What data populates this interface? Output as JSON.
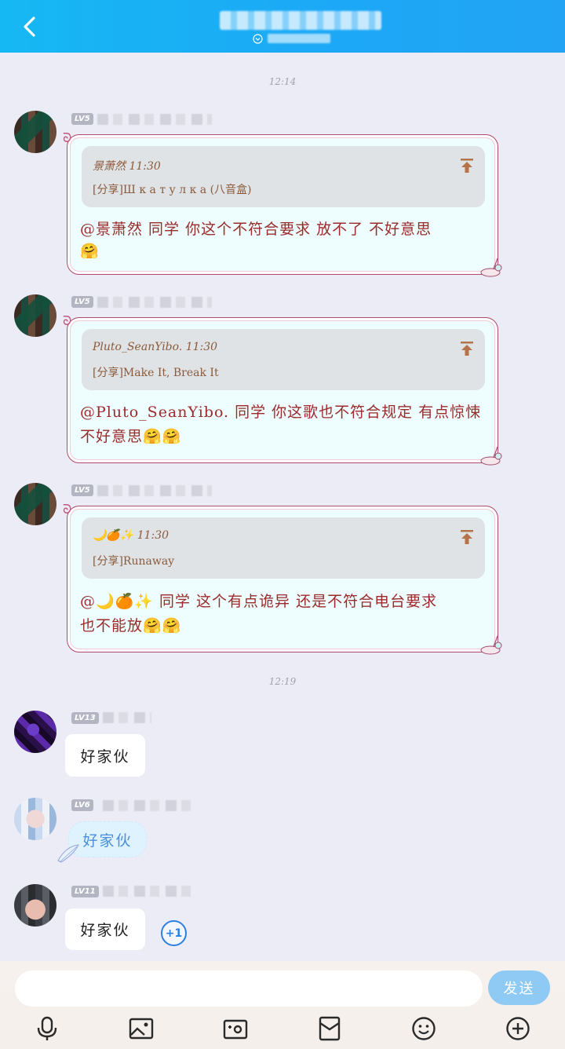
{
  "header": {
    "back_icon": "chevron-left-icon"
  },
  "timestamps": [
    "12:14",
    "12:19"
  ],
  "messages": [
    {
      "level": "LV5",
      "quote_author": "景萧然 11:30",
      "quote_content": "[分享]Ш к а т у л к а (八音盒)",
      "text_line1": "@景萧然 同学 你这个不符合要求 放不了 不好意思",
      "text_line2": "🤗"
    },
    {
      "level": "LV5",
      "quote_author": "Pluto_SeanYibo. 11:30",
      "quote_content": "[分享]Make It, Break It",
      "text_line1": "@Pluto_SeanYibo. 同学 你这歌也不符合规定 有点惊悚",
      "text_line2": "不好意思🤗🤗"
    },
    {
      "level": "LV5",
      "quote_author": "🌙🍊✨ 11:30",
      "quote_content": "[分享]Runaway",
      "text_line1": "@🌙🍊✨ 同学 这个有点诡异 还是不符合电台要求",
      "text_line2": "也不能放🤗🤗"
    },
    {
      "level": "LV13",
      "text": "好家伙"
    },
    {
      "level": "LV6",
      "text": "好家伙"
    },
    {
      "level": "LV11",
      "text": "好家伙",
      "plus_one": "+1"
    }
  ],
  "input": {
    "placeholder": "",
    "value": "",
    "send_label": "发送"
  },
  "toolbar": {
    "icons": [
      "microphone-icon",
      "image-icon",
      "camera-icon",
      "red-packet-icon",
      "emoji-icon",
      "plus-icon"
    ]
  },
  "colors": {
    "header_start": "#16b8f3",
    "header_end": "#22a3f4",
    "background": "#ececf6",
    "fancy_text": "#9b2b2b",
    "send_button": "#8fcaf4",
    "plus_one": "#2d7fe0"
  }
}
